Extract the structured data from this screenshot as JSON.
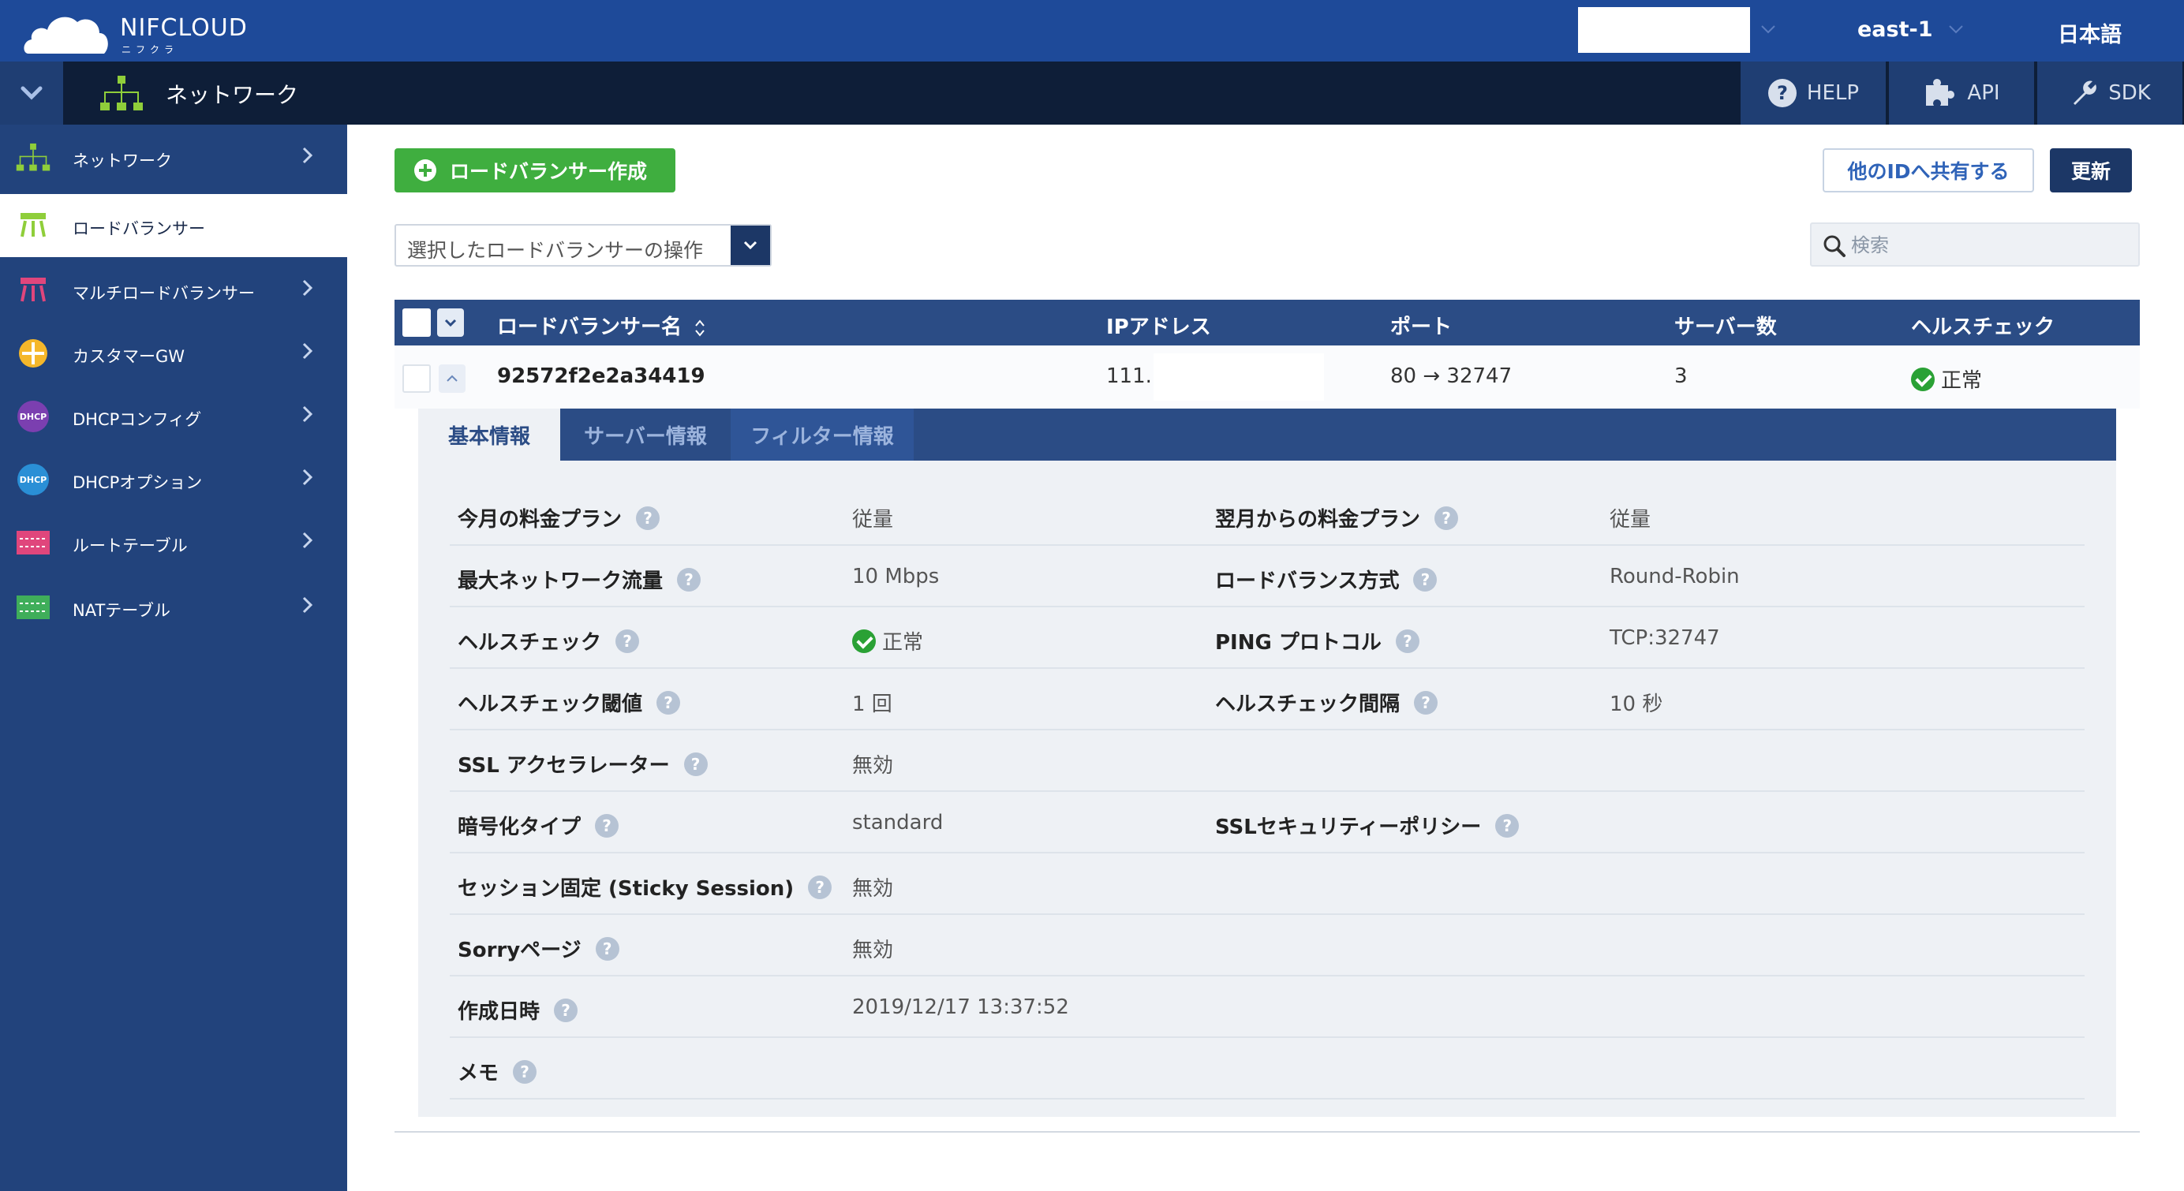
{
  "header": {
    "brand": "NIFCLOUD",
    "brand_sub": "ニフクラ",
    "region": "east-1",
    "language": "日本語"
  },
  "navbar": {
    "title": "ネットワーク",
    "tools": [
      {
        "label": "HELP",
        "icon": "help-circle-icon"
      },
      {
        "label": "API",
        "icon": "puzzle-icon"
      },
      {
        "label": "SDK",
        "icon": "wrench-icon"
      }
    ]
  },
  "sidebar": {
    "items": [
      {
        "label": "ネットワーク",
        "icon": "network-icon",
        "active": false
      },
      {
        "label": "ロードバランサー",
        "icon": "load-balancer-icon",
        "active": true
      },
      {
        "label": "マルチロードバランサー",
        "icon": "multi-load-balancer-icon",
        "active": false
      },
      {
        "label": "カスタマーGW",
        "icon": "customer-gateway-icon",
        "active": false
      },
      {
        "label": "DHCPコンフィグ",
        "icon": "dhcp-config-icon",
        "active": false
      },
      {
        "label": "DHCPオプション",
        "icon": "dhcp-option-icon",
        "active": false
      },
      {
        "label": "ルートテーブル",
        "icon": "route-table-icon",
        "active": false
      },
      {
        "label": "NATテーブル",
        "icon": "nat-table-icon",
        "active": false
      }
    ]
  },
  "toolbar": {
    "create_label": "ロードバランサー作成",
    "share_label": "他のIDへ共有する",
    "refresh_label": "更新",
    "action_select_value": "選択したロードバランサーの操作",
    "search_placeholder": "検索"
  },
  "table": {
    "columns": [
      "ロードバランサー名",
      "IPアドレス",
      "ポート",
      "サーバー数",
      "ヘルスチェック"
    ],
    "rows": [
      {
        "name": "92572f2e2a34419",
        "ip": "111.",
        "port": "80 → 32747",
        "servers": "3",
        "health": "正常"
      }
    ]
  },
  "detail": {
    "tabs": [
      {
        "label": "基本情報",
        "active": true
      },
      {
        "label": "サーバー情報",
        "active": false
      },
      {
        "label": "フィルター情報",
        "active": false
      }
    ],
    "rows": [
      {
        "k1": "今月の料金プラン",
        "v1": "従量",
        "k2": "翌月からの料金プラン",
        "v2": "従量"
      },
      {
        "k1": "最大ネットワーク流量",
        "v1": "10 Mbps",
        "k2": "ロードバランス方式",
        "v2": "Round-Robin"
      },
      {
        "k1": "ヘルスチェック",
        "v1": "正常",
        "k2": "PING プロトコル",
        "v2": "TCP:32747"
      },
      {
        "k1": "ヘルスチェック閾値",
        "v1": "1 回",
        "k2": "ヘルスチェック間隔",
        "v2": "10 秒"
      },
      {
        "k1": "SSL アクセラレーター",
        "v1": "無効"
      },
      {
        "k1": "暗号化タイプ",
        "v1": "standard",
        "k2": "SSLセキュリティーポリシー",
        "v2": ""
      },
      {
        "k1": "セッション固定 (Sticky Session)",
        "v1": "無効"
      },
      {
        "k1": "Sorryページ",
        "v1": "無効"
      },
      {
        "k1": "作成日時",
        "v1": "2019/12/17 13:37:52"
      },
      {
        "k1": "メモ",
        "v1": ""
      }
    ]
  },
  "colors": {
    "header_blue": "#1e4a99",
    "navbar_dark": "#0e1e38",
    "sidebar_blue": "#22437c",
    "table_header": "#2b4c85",
    "create_green": "#3fae3f",
    "ok_green": "#2aa135"
  }
}
